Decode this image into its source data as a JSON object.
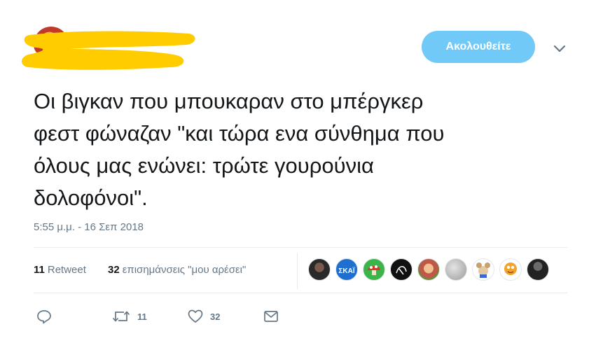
{
  "header": {
    "follow_label": "Ακολουθείτε"
  },
  "tweet": {
    "text": "Οι βιγκαν που μπουκαραν στο μπέργκερ\nφεστ φώναζαν \"και τώρα ενα σύνθημα που\nόλους μας ενώνει: τρώτε γουρούνια\nδολοφόνοι\".",
    "timestamp": "5:55 μ.μ. - 16 Σεπ 2018"
  },
  "stats": {
    "retweet_count": "11",
    "retweet_label": "Retweet",
    "like_count": "32",
    "like_label": "επισημάνσεις \"μου αρέσει\""
  },
  "liker_avatars": [
    {
      "icon": "avatar-dark-portrait",
      "color": "#3a3a3a"
    },
    {
      "icon": "avatar-skai-logo",
      "color": "#1f6fd1"
    },
    {
      "icon": "avatar-mushroom",
      "color": "#3bb54a"
    },
    {
      "icon": "avatar-black-sketch",
      "color": "#111111"
    },
    {
      "icon": "avatar-colorful-figure",
      "color": "#c0584a"
    },
    {
      "icon": "avatar-grey",
      "color": "#b8b8b8"
    },
    {
      "icon": "avatar-cartoon-mouse",
      "color": "#e3c9a0"
    },
    {
      "icon": "avatar-garfield",
      "color": "#f2a42a"
    },
    {
      "icon": "avatar-dark-figure",
      "color": "#222222"
    }
  ],
  "actions": {
    "reply_icon": "reply-icon",
    "retweet_count": "11",
    "like_count": "32",
    "dm_icon": "envelope-icon"
  },
  "colors": {
    "follow_button": "#71c9f8",
    "redaction": "#ffcc00",
    "secondary_text": "#657786"
  }
}
